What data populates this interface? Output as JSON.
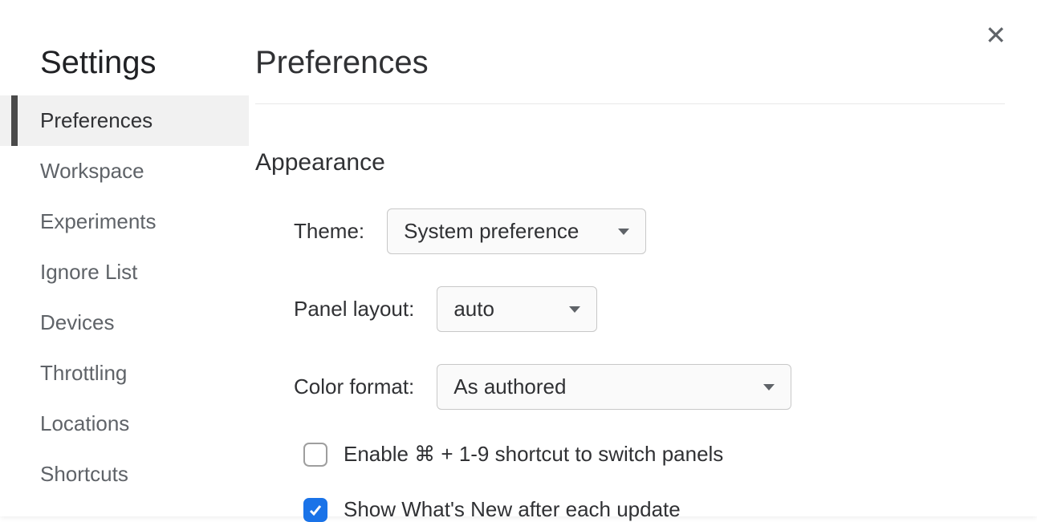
{
  "sidebar": {
    "title": "Settings",
    "items": [
      {
        "label": "Preferences",
        "active": true
      },
      {
        "label": "Workspace",
        "active": false
      },
      {
        "label": "Experiments",
        "active": false
      },
      {
        "label": "Ignore List",
        "active": false
      },
      {
        "label": "Devices",
        "active": false
      },
      {
        "label": "Throttling",
        "active": false
      },
      {
        "label": "Locations",
        "active": false
      },
      {
        "label": "Shortcuts",
        "active": false
      }
    ]
  },
  "main": {
    "title": "Preferences",
    "sections": {
      "appearance": {
        "heading": "Appearance",
        "theme_label": "Theme:",
        "theme_value": "System preference",
        "panel_label": "Panel layout:",
        "panel_value": "auto",
        "color_label": "Color format:",
        "color_value": "As authored",
        "shortcut_checkbox": {
          "checked": false,
          "label": "Enable ⌘ + 1-9 shortcut to switch panels"
        },
        "whatsnew_checkbox": {
          "checked": true,
          "label": "Show What's New after each update"
        }
      }
    }
  }
}
